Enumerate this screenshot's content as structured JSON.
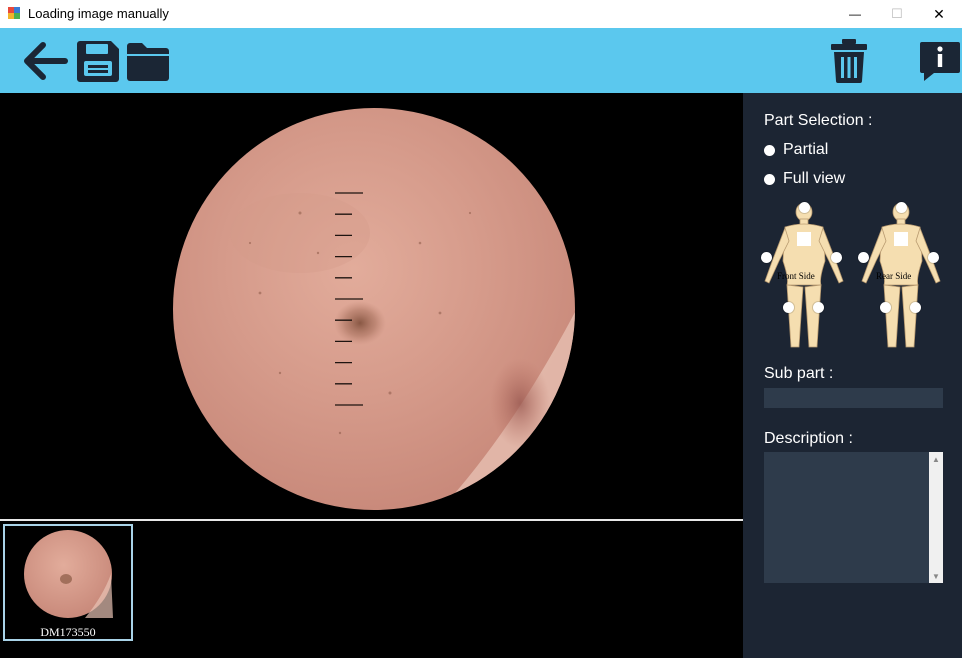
{
  "window": {
    "title": "Loading image manually",
    "minimize_glyph": "—",
    "maximize_glyph": "☐",
    "close_glyph": "✕"
  },
  "toolbar": {
    "background": "#5bc8ee",
    "buttons": [
      {
        "name": "back",
        "icon": "arrow-left-icon"
      },
      {
        "name": "save",
        "icon": "floppy-disk-icon"
      },
      {
        "name": "open",
        "icon": "folder-icon"
      },
      {
        "name": "delete",
        "icon": "trash-icon"
      },
      {
        "name": "info",
        "icon": "info-chat-icon"
      }
    ]
  },
  "viewer": {
    "image": "dermoscopy-skin-lesion",
    "scale_ticks": 11
  },
  "thumbnails": [
    {
      "label": "DM173550",
      "selected": true
    }
  ],
  "sidebar": {
    "part_selection_label": "Part Selection :",
    "options": [
      {
        "label": "Partial"
      },
      {
        "label": "Full view"
      }
    ],
    "front_label": "Front Side",
    "rear_label": "Rear Side",
    "sub_part_label": "Sub part :",
    "sub_part_value": "",
    "description_label": "Description :",
    "description_value": ""
  }
}
